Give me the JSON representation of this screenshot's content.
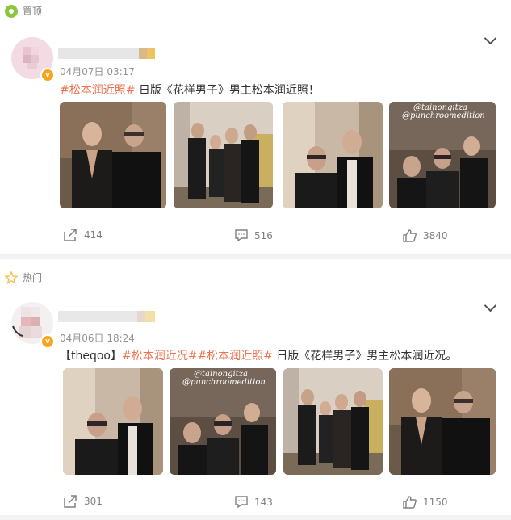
{
  "pinned_label": "置顶",
  "hot_label": "热门",
  "posts": [
    {
      "time": "04月07日 03:17",
      "text_parts": [
        {
          "t": "#松本润近照#",
          "tag": true
        },
        {
          "t": " 日版《花样男子》男主松本润近照！",
          "tag": false
        }
      ],
      "reposts": "414",
      "comments": "516",
      "likes": "3840",
      "photo_texts": [
        "",
        "",
        "",
        "@punchroomedition"
      ]
    },
    {
      "time": "04月06日 18:24",
      "text_parts": [
        {
          "t": "【theqoo】",
          "tag": false
        },
        {
          "t": "#松本润近况##松本润近照#",
          "tag": true
        },
        {
          "t": " 日版《花样男子》男主松本润近况。",
          "tag": false
        }
      ],
      "reposts": "301",
      "comments": "143",
      "likes": "1150",
      "photo_texts": [
        "",
        "@punchroomedition",
        "",
        ""
      ]
    }
  ],
  "colors": {
    "tag": "#eb7350",
    "pin": "#8cc63f",
    "verified": "#f7a51c",
    "hot": "#f7c04a"
  }
}
